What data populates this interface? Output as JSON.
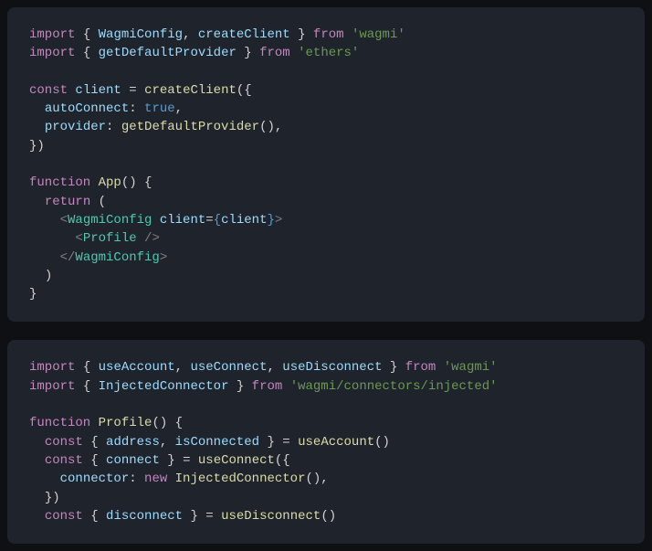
{
  "block1": {
    "l1": {
      "kw1": "import",
      "b1": "{ ",
      "i1": "WagmiConfig",
      "c1": ", ",
      "i2": "createClient",
      "b2": " }",
      "kw2": " from ",
      "s1": "'wagmi'"
    },
    "l2": {
      "kw1": "import",
      "b1": "{ ",
      "i1": "getDefaultProvider",
      "b2": " }",
      "kw2": " from ",
      "s1": "'ethers'"
    },
    "l3": {
      "kw1": "const ",
      "i1": "client",
      "eq": " = ",
      "fn1": "createClient",
      "p1": "({"
    },
    "l4": {
      "sp": "  ",
      "i1": "autoConnect",
      "c1": ": ",
      "v1": "true",
      "c2": ","
    },
    "l5": {
      "sp": "  ",
      "i1": "provider",
      "c1": ": ",
      "fn1": "getDefaultProvider",
      "p1": "(),"
    },
    "l6": {
      "p1": "})"
    },
    "l7": {
      "kw1": "function ",
      "fn1": "App",
      "p1": "() {"
    },
    "l8": {
      "sp": "  ",
      "kw1": "return",
      "p1": " ("
    },
    "l9": {
      "sp": "    ",
      "a1": "<",
      "t1": "WagmiConfig",
      "sp2": " ",
      "at1": "client",
      "eq": "=",
      "b1": "{",
      "i1": "client",
      "b2": "}",
      "a2": ">"
    },
    "l10": {
      "sp": "      ",
      "a1": "<",
      "t1": "Profile",
      "sp2": " ",
      "a2": "/>"
    },
    "l11": {
      "sp": "    ",
      "a1": "</",
      "t1": "WagmiConfig",
      "a2": ">"
    },
    "l12": {
      "sp": "  ",
      "p1": ")"
    },
    "l13": {
      "p1": "}"
    }
  },
  "block2": {
    "l1": {
      "kw1": "import",
      "b1": "{ ",
      "i1": "useAccount",
      "c1": ", ",
      "i2": "useConnect",
      "c2": ", ",
      "i3": "useDisconnect",
      "b2": " }",
      "kw2": " from ",
      "s1": "'wagmi'"
    },
    "l2": {
      "kw1": "import",
      "b1": "{ ",
      "i1": "InjectedConnector",
      "b2": " }",
      "kw2": " from ",
      "s1": "'wagmi/connectors/injected'"
    },
    "l3": {
      "kw1": "function ",
      "fn1": "Profile",
      "p1": "() {"
    },
    "l4": {
      "sp": "  ",
      "kw1": "const ",
      "b1": "{ ",
      "i1": "address",
      "c1": ", ",
      "i2": "isConnected",
      "b2": " }",
      "eq": " = ",
      "fn1": "useAccount",
      "p1": "()"
    },
    "l5": {
      "sp": "  ",
      "kw1": "const ",
      "b1": "{ ",
      "i1": "connect",
      "b2": " }",
      "eq": " = ",
      "fn1": "useConnect",
      "p1": "({"
    },
    "l6": {
      "sp": "    ",
      "i1": "connector",
      "c1": ": ",
      "kw1": "new ",
      "fn1": "InjectedConnector",
      "p1": "(),"
    },
    "l7": {
      "sp": "  ",
      "p1": "})"
    },
    "l8": {
      "sp": "  ",
      "kw1": "const ",
      "b1": "{ ",
      "i1": "disconnect",
      "b2": " }",
      "eq": " = ",
      "fn1": "useDisconnect",
      "p1": "()"
    }
  }
}
